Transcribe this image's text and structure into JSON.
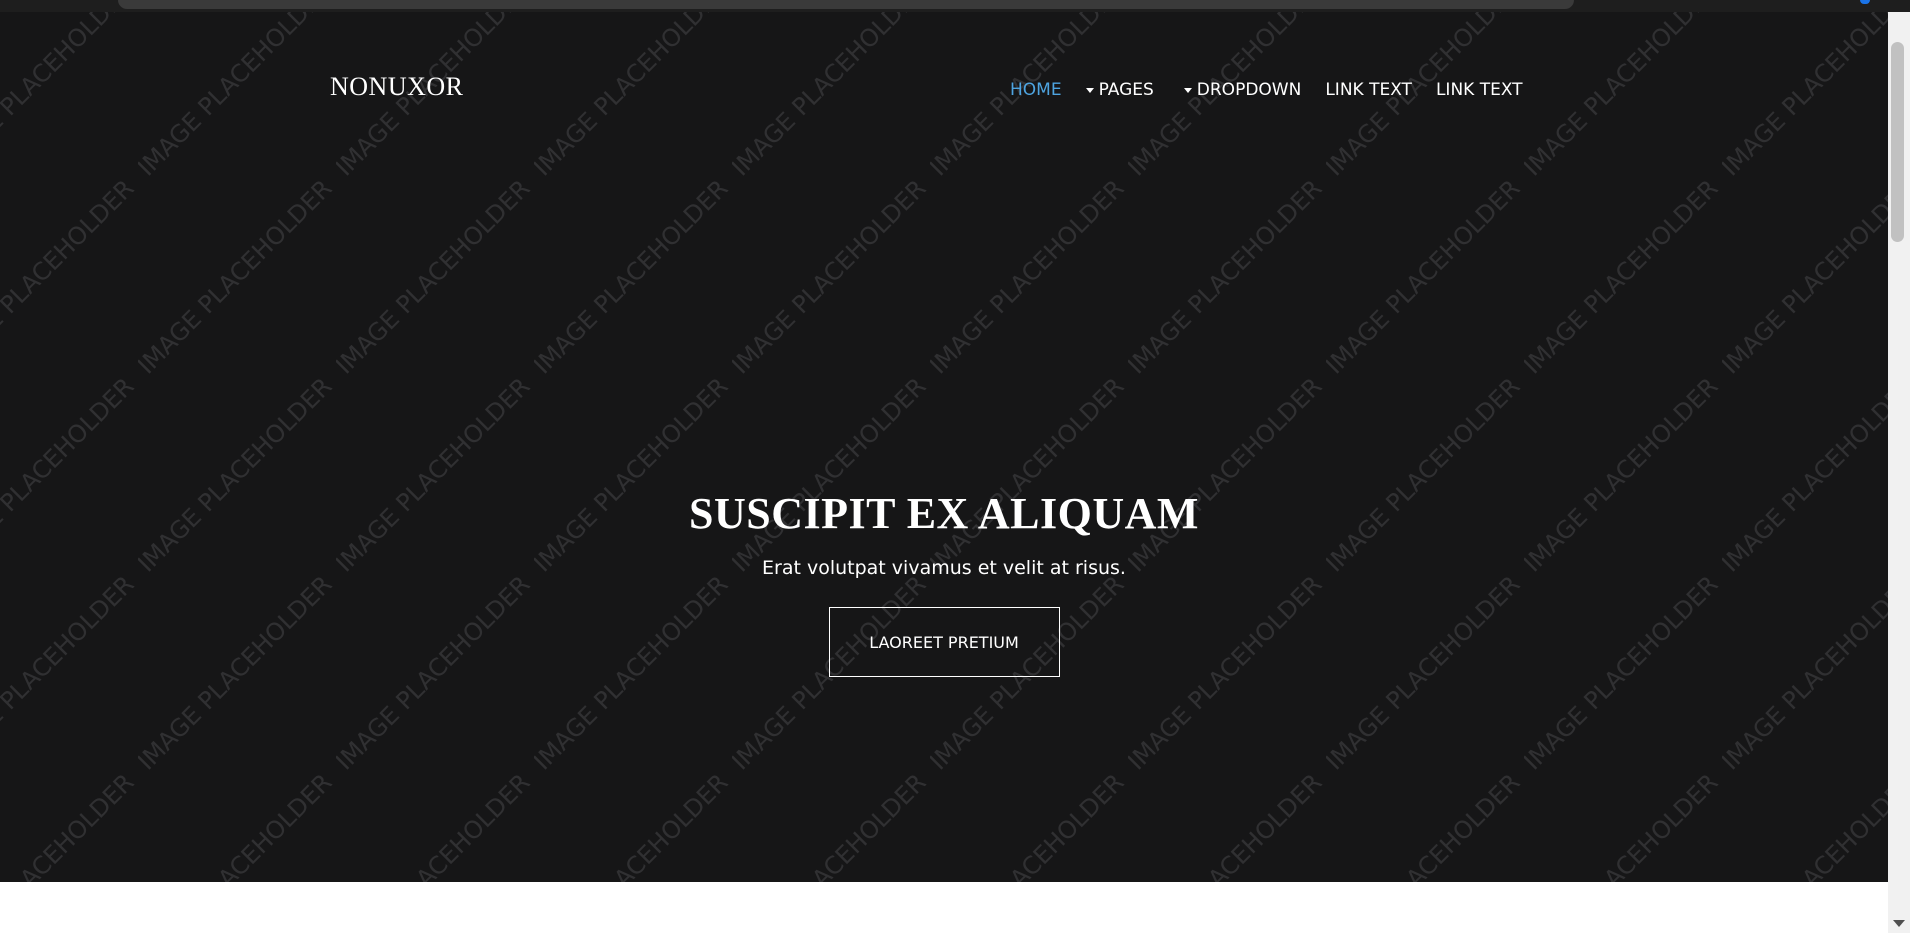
{
  "brand": {
    "name": "NONUXOR"
  },
  "nav": {
    "home": "HOME",
    "pages": "PAGES",
    "dropdown": "DROPDOWN",
    "link1": "LINK TEXT",
    "link2": "LINK TEXT"
  },
  "hero": {
    "title": "SUSCIPIT EX ALIQUAM",
    "subtitle": "Erat volutpat vivamus et velit at risus.",
    "button_label": "LAOREET PRETIUM",
    "background_watermark": "IMAGE PLACEHOLDER"
  },
  "colors": {
    "hero_background": "#161617",
    "active_nav": "#4ea4e0",
    "text": "#ffffff"
  },
  "icons": {
    "pages_caret": "caret-down-icon",
    "dropdown_caret": "caret-down-icon",
    "scroll_down": "arrow-down-icon"
  }
}
